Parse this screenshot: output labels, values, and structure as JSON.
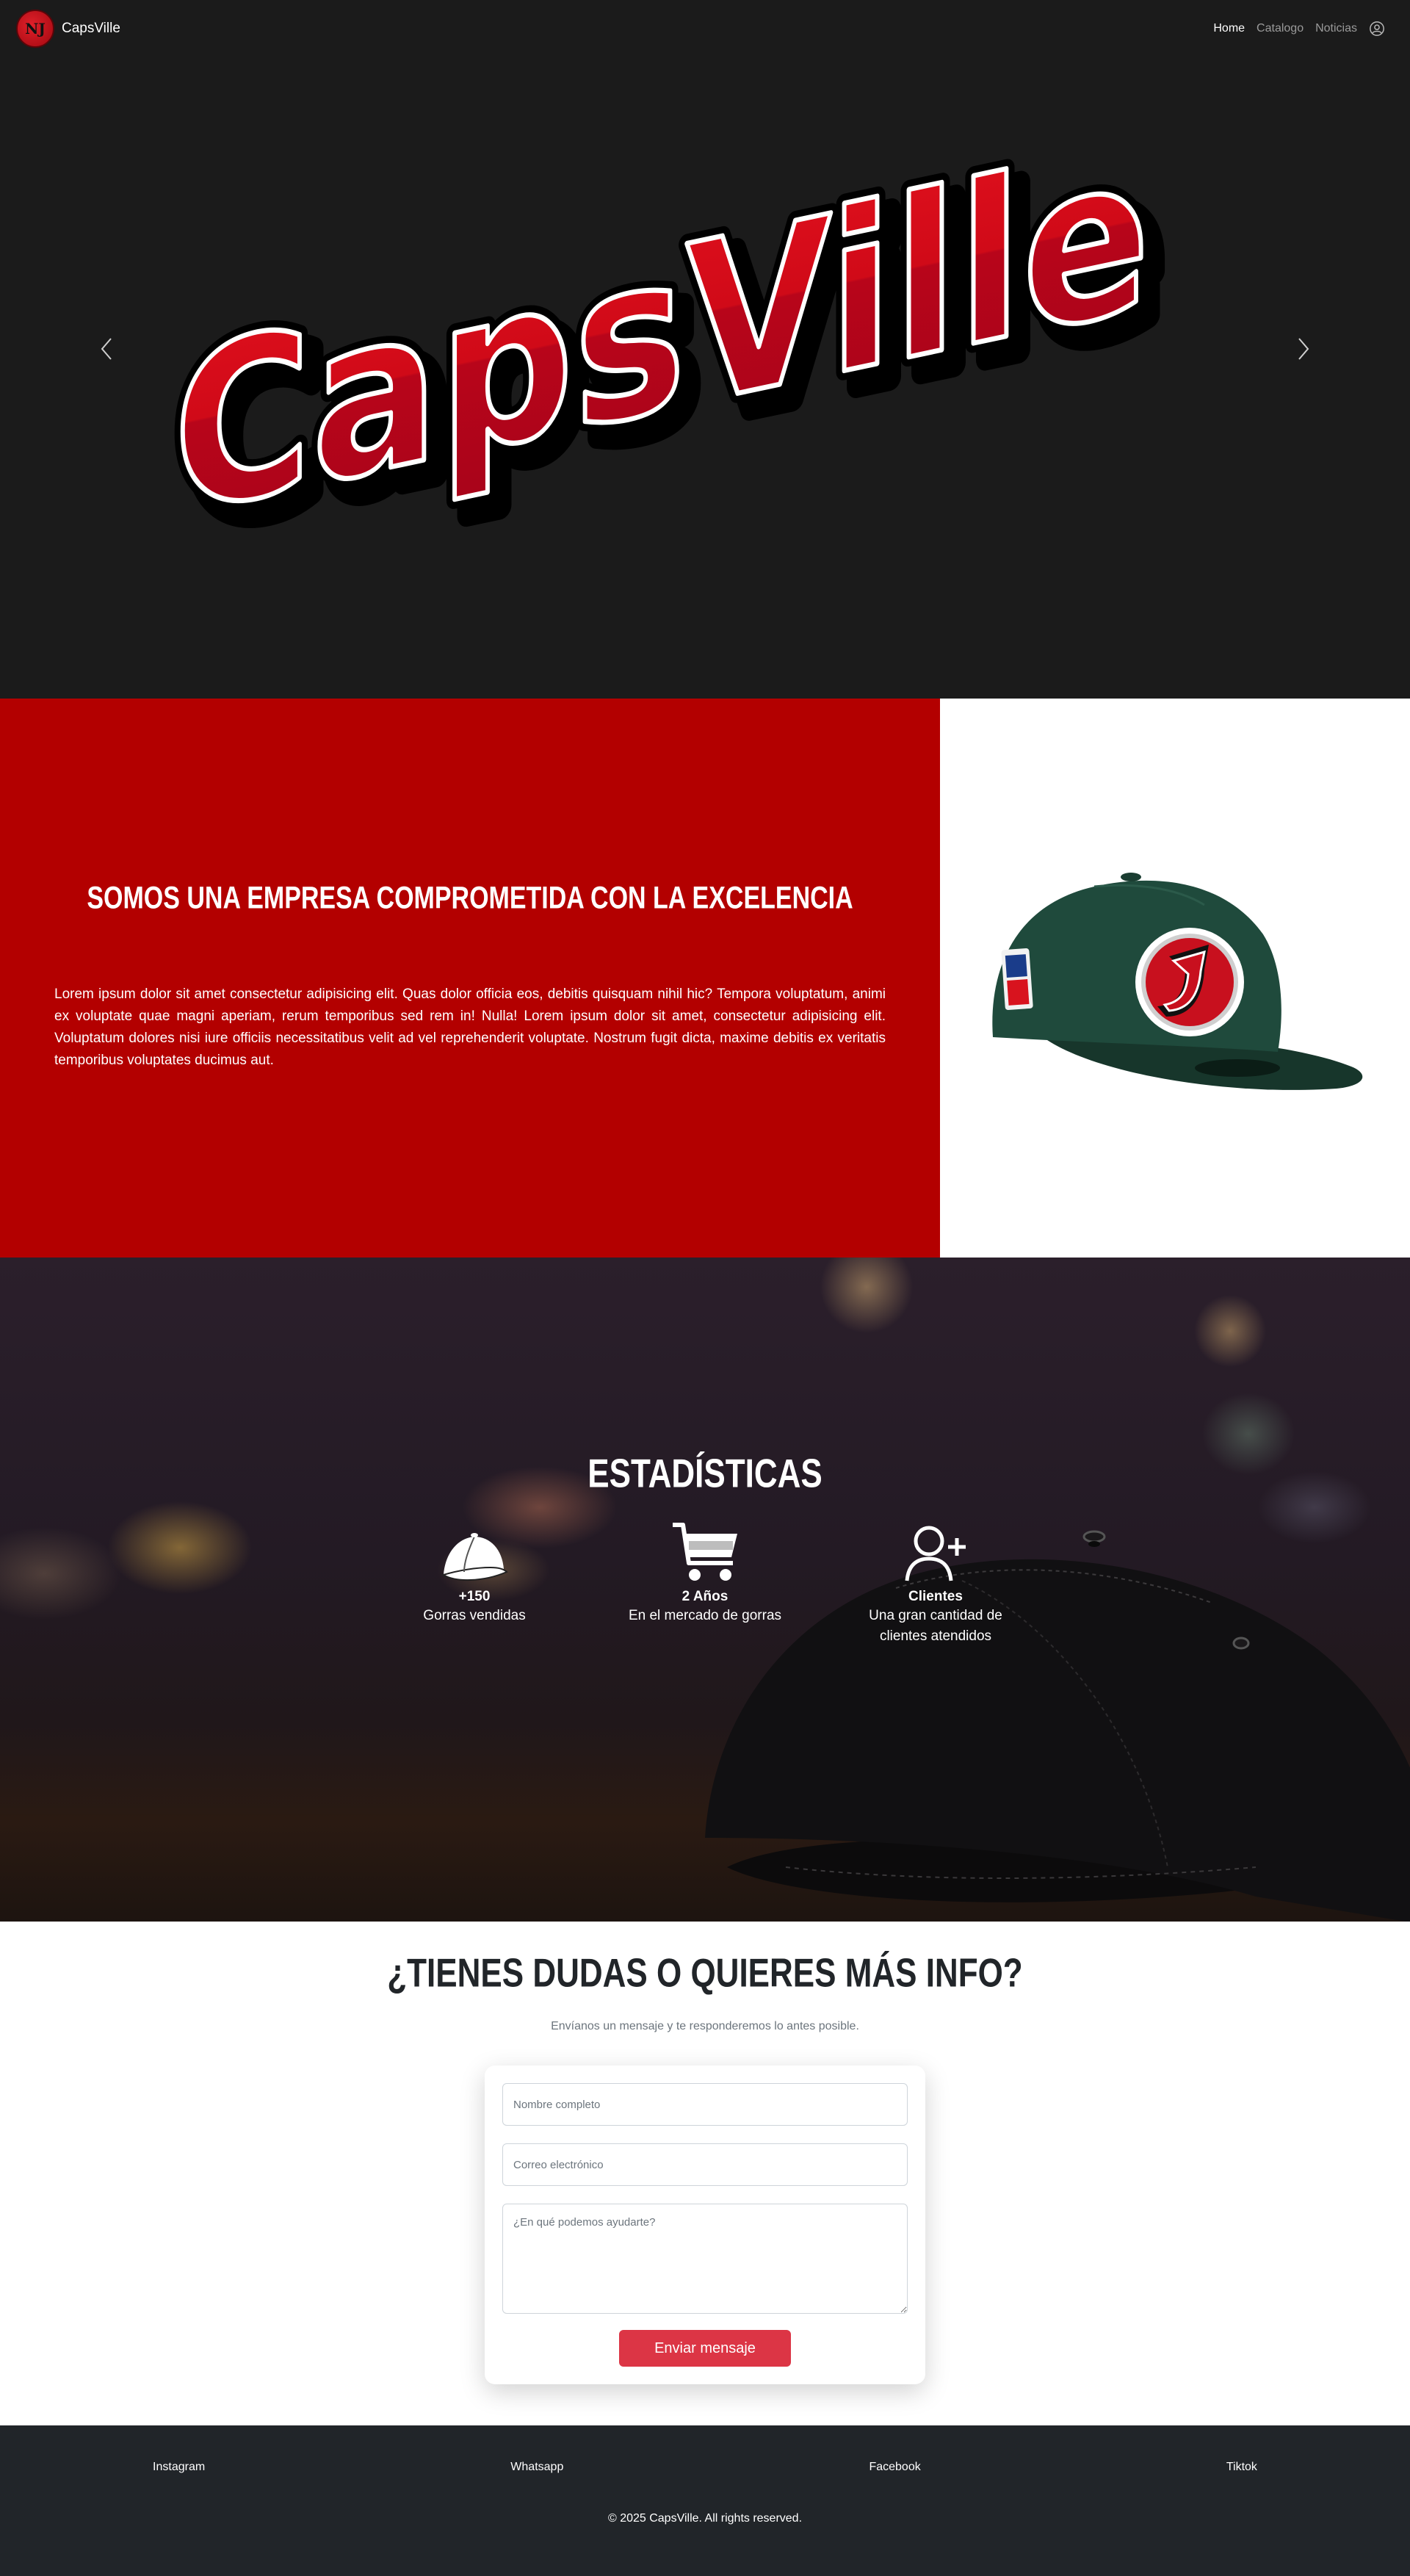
{
  "nav": {
    "brand": "CapsVille",
    "logo_text": "NJ",
    "links": [
      {
        "label": "Home",
        "active": true
      },
      {
        "label": "Catalogo",
        "active": false
      },
      {
        "label": "Noticias",
        "active": false
      }
    ]
  },
  "hero": {
    "logo_text": "CapsVille"
  },
  "about": {
    "title": "SOMOS UNA EMPRESA COMPROMETIDA CON LA EXCELENCIA",
    "text": "Lorem ipsum dolor sit amet consectetur adipisicing elit. Quas dolor officia eos, debitis quisquam nihil hic? Tempora voluptatum, animi ex voluptate quae magni aperiam, rerum temporibus sed rem in! Nulla! Lorem ipsum dolor sit amet, consectetur adipisicing elit. Voluptatum dolores nisi iure officiis necessitatibus velit ad vel reprehenderit voluptate. Nostrum fugit dicta, maxime debitis ex veritatis temporibus voluptates ducimus aut."
  },
  "stats": {
    "title": "ESTADÍSTICAS",
    "items": [
      {
        "icon": "cap-icon",
        "value": "+150",
        "label": "Gorras vendidas"
      },
      {
        "icon": "cart-icon",
        "value": "2 Años",
        "label": "En el mercado de gorras"
      },
      {
        "icon": "user-add-icon",
        "value": "Clientes",
        "label": "Una gran cantidad de clientes atendidos"
      }
    ]
  },
  "contact": {
    "title": "¿TIENES DUDAS O QUIERES MÁS INFO?",
    "subtitle": "Envíanos un mensaje y te responderemos lo antes posible.",
    "name_placeholder": "Nombre completo",
    "email_placeholder": "Correo electrónico",
    "message_placeholder": "¿En qué podemos ayudarte?",
    "submit_label": "Enviar mensaje"
  },
  "footer": {
    "links": [
      "Instagram",
      "Whatsapp",
      "Facebook",
      "Tiktok"
    ],
    "copyright": "© 2025 CapsVille. All rights reserved."
  },
  "colors": {
    "brand_red": "#b30000",
    "button_red": "#dc3545",
    "dark_bg": "#1b1b1b",
    "footer_bg": "#212529"
  }
}
